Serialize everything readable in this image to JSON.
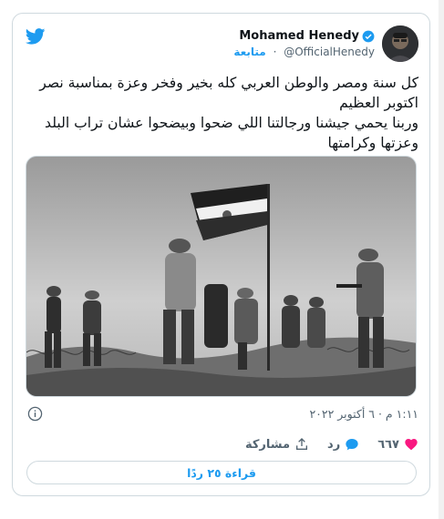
{
  "tweet": {
    "author_name": "Mohamed Henedy",
    "handle": "@OfficialHenedy",
    "follow_label": "متابعة",
    "separator": "·",
    "text": "كل سنة ومصر والوطن العربي  كله بخير وفخر وعزة بمناسبة نصر اكتوبر العظيم\nوربنا يحمي جيشنا ورجالتنا اللي ضحوا وبيضحوا عشان تراب البلد وعزتها وكرامتها",
    "timestamp": "١:١١ م · ٦ أكتوبر ٢٠٢٢",
    "like_count": "٦٦٧",
    "reply_label": "رد",
    "share_label": "مشاركة",
    "read_replies_label": "قراءة ٢٥ ردًا"
  },
  "icons": {
    "brand": "twitter-bird-icon",
    "verified": "verified-badge-icon",
    "info": "info-icon",
    "like": "heart-icon",
    "reply": "speech-bubble-icon",
    "share": "share-upload-icon"
  },
  "colors": {
    "accent": "#1d9bf0",
    "like": "#f91880",
    "text": "#0f1419",
    "muted": "#536471",
    "border": "#cfd9de"
  }
}
